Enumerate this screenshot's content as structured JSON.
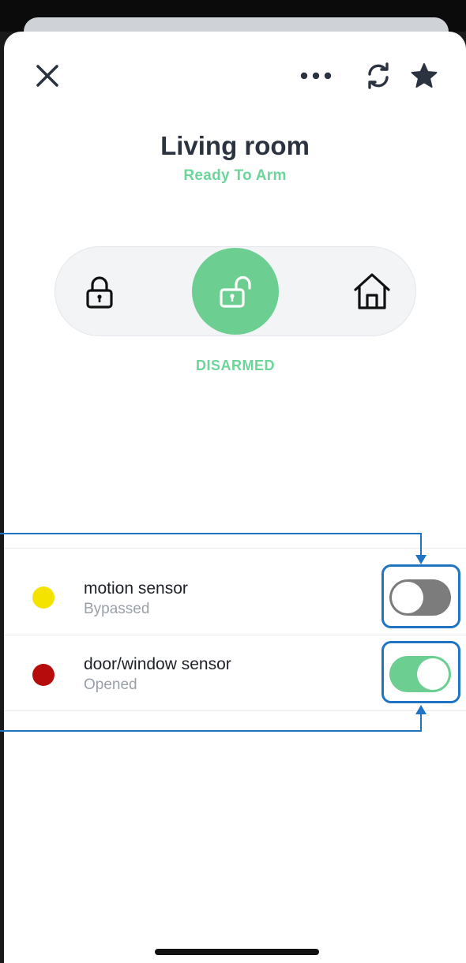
{
  "header": {
    "title": "Living room",
    "status": "Ready To Arm"
  },
  "icons": {
    "close": "close-icon",
    "more": "more-icon",
    "refresh": "refresh-icon",
    "favorite": "star-icon",
    "away": "lock-closed-icon",
    "disarm": "lock-open-icon",
    "home": "house-icon"
  },
  "security": {
    "modes": [
      "away",
      "disarm",
      "home"
    ],
    "selected": "disarm",
    "state_label": "DISARMED"
  },
  "sensors": [
    {
      "name": "motion sensor",
      "status": "Bypassed",
      "dot_color": "#f4e300",
      "toggle_on": false
    },
    {
      "name": "door/window sensor",
      "status": "Opened",
      "dot_color": "#b60c0c",
      "toggle_on": true
    }
  ],
  "colors": {
    "accent_green": "#6ccf91",
    "title_text": "#2c3340",
    "callout_blue": "#1f74c4",
    "toggle_off": "#7c7c7c"
  }
}
